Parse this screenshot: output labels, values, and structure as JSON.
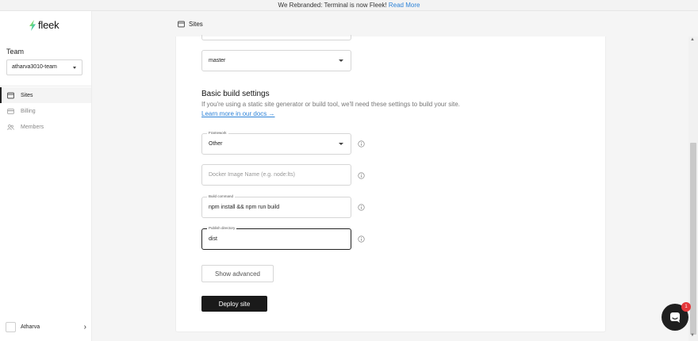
{
  "banner": {
    "text": "We Rebranded: Terminal is now Fleek!",
    "link": "Read More"
  },
  "brand": {
    "name": "fleek"
  },
  "sidebar": {
    "team_label": "Team",
    "team_value": "atharva3010-team",
    "items": [
      {
        "label": "Sites",
        "icon": "browser-icon",
        "active": true
      },
      {
        "label": "Billing",
        "icon": "card-icon",
        "active": false
      },
      {
        "label": "Members",
        "icon": "people-icon",
        "active": false
      }
    ],
    "user_name": "Atharva"
  },
  "topbar": {
    "title": "Sites"
  },
  "form": {
    "branch_value": "master",
    "section_title": "Basic build settings",
    "section_desc": "If you're using a static site generator or build tool, we'll need these settings to build your site.",
    "learn_more": "Learn more in our docs →",
    "framework": {
      "label": "Framework",
      "value": "Other"
    },
    "docker": {
      "placeholder": "Docker Image Name (e.g. node:lts)"
    },
    "build_command": {
      "label": "Build command",
      "value": "npm install && npm run build"
    },
    "publish_dir": {
      "label": "Publish directory",
      "value": "dist"
    },
    "show_advanced": "Show advanced",
    "deploy": "Deploy site"
  },
  "chat": {
    "badge": "1"
  },
  "colors": {
    "link": "#2e83d8",
    "primary_button": "#1a1a1a",
    "badge": "#e5383b"
  }
}
